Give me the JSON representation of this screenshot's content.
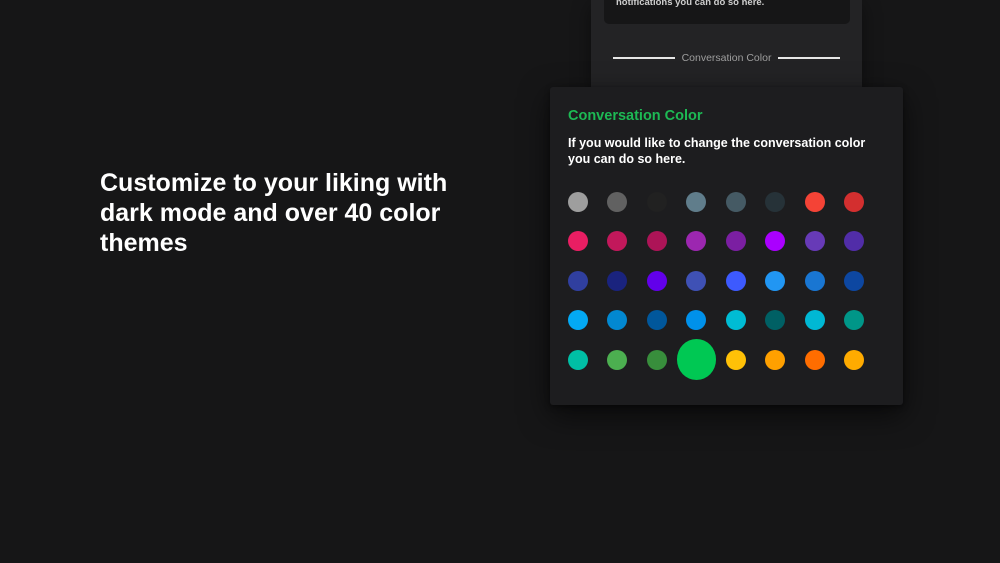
{
  "headline": "Customize to your liking with dark mode and over 40 color themes",
  "previous_card": {
    "text": "notifications you can do so here."
  },
  "section_header": {
    "label": "Conversation Color"
  },
  "color_card": {
    "title": "Conversation Color",
    "title_color": "#1db954",
    "description": "If you would like to change the conversation color you can do so here."
  },
  "swatches": [
    {
      "name": "light-gray",
      "color": "#9e9e9e",
      "selected": false
    },
    {
      "name": "gray",
      "color": "#616161",
      "selected": false
    },
    {
      "name": "charcoal",
      "color": "#212121",
      "selected": false
    },
    {
      "name": "blue-gray-light",
      "color": "#607d8b",
      "selected": false
    },
    {
      "name": "blue-gray",
      "color": "#455a64",
      "selected": false
    },
    {
      "name": "blue-gray-dark",
      "color": "#263238",
      "selected": false
    },
    {
      "name": "red-orange",
      "color": "#f44336",
      "selected": false
    },
    {
      "name": "red",
      "color": "#d32f2f",
      "selected": false
    },
    {
      "name": "pink",
      "color": "#e91e63",
      "selected": false
    },
    {
      "name": "pink-dark",
      "color": "#c2185b",
      "selected": false
    },
    {
      "name": "magenta",
      "color": "#ad1457",
      "selected": false
    },
    {
      "name": "purple",
      "color": "#9c27b0",
      "selected": false
    },
    {
      "name": "purple-dark",
      "color": "#7b1fa2",
      "selected": false
    },
    {
      "name": "violet",
      "color": "#aa00ff",
      "selected": false
    },
    {
      "name": "deep-purple",
      "color": "#673ab7",
      "selected": false
    },
    {
      "name": "deep-purple-dark",
      "color": "#512da8",
      "selected": false
    },
    {
      "name": "indigo",
      "color": "#303f9f",
      "selected": false
    },
    {
      "name": "indigo-dark",
      "color": "#1a237e",
      "selected": false
    },
    {
      "name": "electric-violet",
      "color": "#6200ea",
      "selected": false
    },
    {
      "name": "indigo-light",
      "color": "#3f51b5",
      "selected": false
    },
    {
      "name": "blue-accent",
      "color": "#3d5afe",
      "selected": false
    },
    {
      "name": "sky-blue",
      "color": "#2196f3",
      "selected": false
    },
    {
      "name": "blue",
      "color": "#1976d2",
      "selected": false
    },
    {
      "name": "blue-dark",
      "color": "#0d47a1",
      "selected": false
    },
    {
      "name": "light-blue",
      "color": "#03a9f4",
      "selected": false
    },
    {
      "name": "light-blue-dark",
      "color": "#0288d1",
      "selected": false
    },
    {
      "name": "cobalt",
      "color": "#01579b",
      "selected": false
    },
    {
      "name": "azure",
      "color": "#0091ea",
      "selected": false
    },
    {
      "name": "cyan",
      "color": "#00bcd4",
      "selected": false
    },
    {
      "name": "teal-dark",
      "color": "#006064",
      "selected": false
    },
    {
      "name": "cyan-light",
      "color": "#00b8d4",
      "selected": false
    },
    {
      "name": "teal",
      "color": "#009688",
      "selected": false
    },
    {
      "name": "turquoise",
      "color": "#00bfa5",
      "selected": false
    },
    {
      "name": "green",
      "color": "#4caf50",
      "selected": false
    },
    {
      "name": "green-dark",
      "color": "#388e3c",
      "selected": false
    },
    {
      "name": "vivid-green",
      "color": "#00c853",
      "selected": true
    },
    {
      "name": "amber",
      "color": "#ffc107",
      "selected": false
    },
    {
      "name": "orange-amber",
      "color": "#ffa000",
      "selected": false
    },
    {
      "name": "orange",
      "color": "#ff6d00",
      "selected": false
    },
    {
      "name": "gold",
      "color": "#ffab00",
      "selected": false
    }
  ]
}
